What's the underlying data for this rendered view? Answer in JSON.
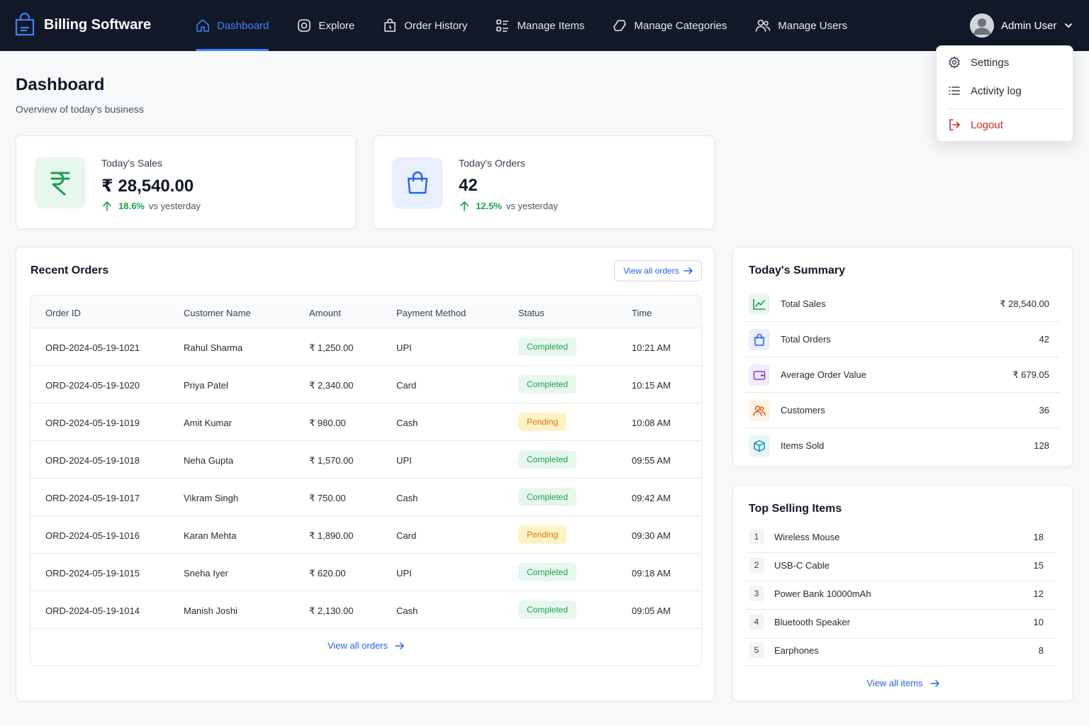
{
  "brand": {
    "name": "Billing Software",
    "icon": "shopping-bag-icon"
  },
  "nav": [
    {
      "label": "Dashboard",
      "icon": "home-icon",
      "active": true
    },
    {
      "label": "Explore",
      "icon": "explore-icon"
    },
    {
      "label": "Order History",
      "icon": "order-history-icon"
    },
    {
      "label": "Manage Items",
      "icon": "list-icon"
    },
    {
      "label": "Manage Categories",
      "icon": "category-icon"
    },
    {
      "label": "Manage Users",
      "icon": "users-icon"
    }
  ],
  "user": {
    "name": "Admin User"
  },
  "dropdown": {
    "settings": "Settings",
    "activity": "Activity log",
    "logout": "Logout"
  },
  "page": {
    "title": "Dashboard",
    "subtitle": "Overview of today's business"
  },
  "stats": {
    "sales": {
      "label": "Today's Sales",
      "value": "₹ 28,540.00",
      "delta": "18.6%",
      "note": "vs yesterday"
    },
    "orders": {
      "label": "Today's Orders",
      "value": "42",
      "delta": "12.5%",
      "note": "vs yesterday"
    }
  },
  "recent": {
    "title": "Recent Orders",
    "view_all": "View all orders",
    "columns": [
      "Order ID",
      "Customer Name",
      "Amount",
      "Payment Method",
      "Status",
      "Time"
    ],
    "rows": [
      {
        "id": "ORD-2024-05-19-1021",
        "customer": "Rahul Sharma",
        "amount": "₹ 1,250.00",
        "method": "UPI",
        "status": "Completed",
        "time": "10:21 AM"
      },
      {
        "id": "ORD-2024-05-19-1020",
        "customer": "Priya Patel",
        "amount": "₹ 2,340.00",
        "method": "Card",
        "status": "Completed",
        "time": "10:15 AM"
      },
      {
        "id": "ORD-2024-05-19-1019",
        "customer": "Amit Kumar",
        "amount": "₹ 980.00",
        "method": "Cash",
        "status": "Pending",
        "time": "10:08 AM"
      },
      {
        "id": "ORD-2024-05-19-1018",
        "customer": "Neha Gupta",
        "amount": "₹ 1,570.00",
        "method": "UPI",
        "status": "Completed",
        "time": "09:55 AM"
      },
      {
        "id": "ORD-2024-05-19-1017",
        "customer": "Vikram Singh",
        "amount": "₹ 750.00",
        "method": "Cash",
        "status": "Completed",
        "time": "09:42 AM"
      },
      {
        "id": "ORD-2024-05-19-1016",
        "customer": "Karan Mehta",
        "amount": "₹ 1,890.00",
        "method": "Card",
        "status": "Pending",
        "time": "09:30 AM"
      },
      {
        "id": "ORD-2024-05-19-1015",
        "customer": "Sneha Iyer",
        "amount": "₹ 620.00",
        "method": "UPI",
        "status": "Completed",
        "time": "09:18 AM"
      },
      {
        "id": "ORD-2024-05-19-1014",
        "customer": "Manish Joshi",
        "amount": "₹ 2,130.00",
        "method": "Cash",
        "status": "Completed",
        "time": "09:05 AM"
      }
    ]
  },
  "summary": {
    "title": "Today's Summary",
    "rows": [
      {
        "label": "Total Sales",
        "value": "₹ 28,540.00",
        "icon": "trend-icon",
        "color": "#16a34a",
        "bg": "#e8f7ee"
      },
      {
        "label": "Total Orders",
        "value": "42",
        "icon": "bag-icon",
        "color": "#2563eb",
        "bg": "#e8f0fe"
      },
      {
        "label": "Average Order Value",
        "value": "₹ 679.05",
        "icon": "wallet-icon",
        "color": "#7c3aed",
        "bg": "#f1ebfe"
      },
      {
        "label": "Customers",
        "value": "36",
        "icon": "customers-icon",
        "color": "#ea580c",
        "bg": "#fff1e6"
      },
      {
        "label": "Items Sold",
        "value": "128",
        "icon": "box-icon",
        "color": "#0891b2",
        "bg": "#e6f7fa"
      }
    ]
  },
  "top": {
    "title": "Top Selling Items",
    "view_all": "View all items",
    "items": [
      {
        "rank": "1",
        "name": "Wireless Mouse",
        "qty": "18"
      },
      {
        "rank": "2",
        "name": "USB-C Cable",
        "qty": "15"
      },
      {
        "rank": "3",
        "name": "Power Bank 10000mAh",
        "qty": "12"
      },
      {
        "rank": "4",
        "name": "Bluetooth Speaker",
        "qty": "10"
      },
      {
        "rank": "5",
        "name": "Earphones",
        "qty": "8"
      }
    ]
  },
  "colors": {
    "accent": "#3b82f6",
    "topbar": "#111827",
    "success": "#16a34a",
    "warning": "#d97706",
    "danger": "#dc2626"
  }
}
